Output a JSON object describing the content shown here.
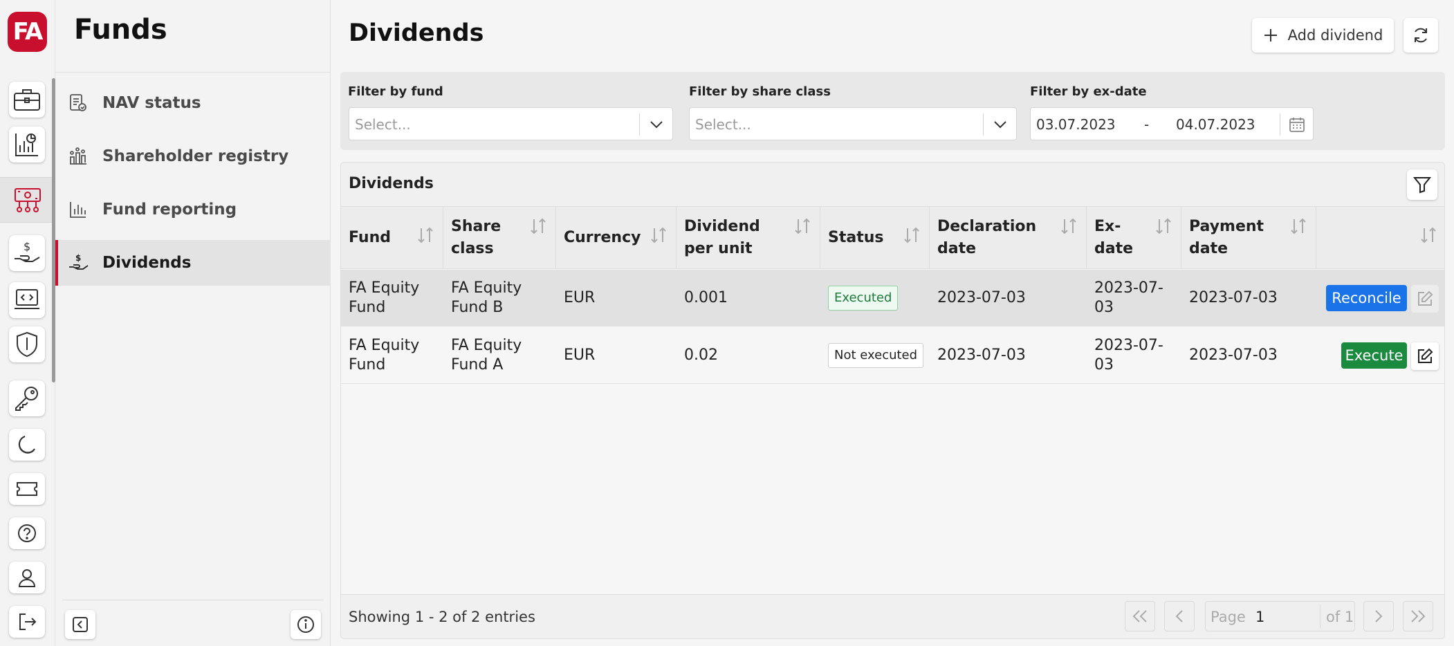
{
  "app": {
    "logo_text": "FA"
  },
  "rail": {
    "items": [
      {
        "icon": "briefcase-icon"
      },
      {
        "icon": "chart-icon"
      },
      {
        "icon": "funds-icon"
      },
      {
        "icon": "hand-dollar-icon"
      },
      {
        "icon": "laptop-code-icon"
      },
      {
        "icon": "shield-icon"
      },
      {
        "icon": "key-icon"
      },
      {
        "icon": "moon-icon"
      },
      {
        "icon": "ticket-icon"
      },
      {
        "icon": "help-icon"
      },
      {
        "icon": "user-icon"
      },
      {
        "icon": "logout-icon"
      }
    ],
    "active_icon": "funds-icon"
  },
  "sidebar": {
    "title": "Funds",
    "items": [
      {
        "label": "NAV status",
        "icon": "nav-status-icon"
      },
      {
        "label": "Shareholder registry",
        "icon": "registry-icon"
      },
      {
        "label": "Fund reporting",
        "icon": "reporting-icon"
      },
      {
        "label": "Dividends",
        "icon": "dividends-icon",
        "active": true
      }
    ]
  },
  "main": {
    "title": "Dividends",
    "add_button": "Add dividend",
    "filters": {
      "fund": {
        "label": "Filter by fund",
        "placeholder": "Select..."
      },
      "share_class": {
        "label": "Filter by share class",
        "placeholder": "Select..."
      },
      "ex_date": {
        "label": "Filter by ex-date",
        "from": "03.07.2023",
        "separator": "-",
        "to": "04.07.2023"
      }
    },
    "table": {
      "title": "Dividends",
      "columns": [
        {
          "line1": "Fund",
          "line2": ""
        },
        {
          "line1": "Share",
          "line2": "class"
        },
        {
          "line1": "Currency",
          "line2": ""
        },
        {
          "line1": "Dividend",
          "line2": "per unit"
        },
        {
          "line1": "Status",
          "line2": ""
        },
        {
          "line1": "Declaration",
          "line2": "date"
        },
        {
          "line1": "Ex-",
          "line2": "date"
        },
        {
          "line1": "Payment",
          "line2": "date"
        },
        {
          "line1": "",
          "line2": ""
        }
      ],
      "rows": [
        {
          "fund_l1": "FA Equity",
          "fund_l2": "Fund",
          "share_l1": "FA Equity",
          "share_l2": "Fund B",
          "currency": "EUR",
          "dpu": "0.001",
          "status": "Executed",
          "declaration": "2023-07-03",
          "ex_l1": "2023-07-",
          "ex_l2": "03",
          "payment": "2023-07-03",
          "action": "Reconcile",
          "action_color": "#1a73e8"
        },
        {
          "fund_l1": "FA Equity",
          "fund_l2": "Fund",
          "share_l1": "FA Equity",
          "share_l2": "Fund A",
          "currency": "EUR",
          "dpu": "0.02",
          "status": "Not executed",
          "declaration": "2023-07-03",
          "ex_l1": "2023-07-",
          "ex_l2": "03",
          "payment": "2023-07-03",
          "action": "Execute",
          "action_color": "#1a8a3f"
        }
      ],
      "footer": "Showing 1 - 2 of 2 entries",
      "pagination": {
        "page_label": "Page",
        "page": "1",
        "of_label": "of 1"
      }
    }
  },
  "colors": {
    "brand": "#c8102e",
    "reconcile": "#1a73e8",
    "execute": "#1a8a3f"
  }
}
